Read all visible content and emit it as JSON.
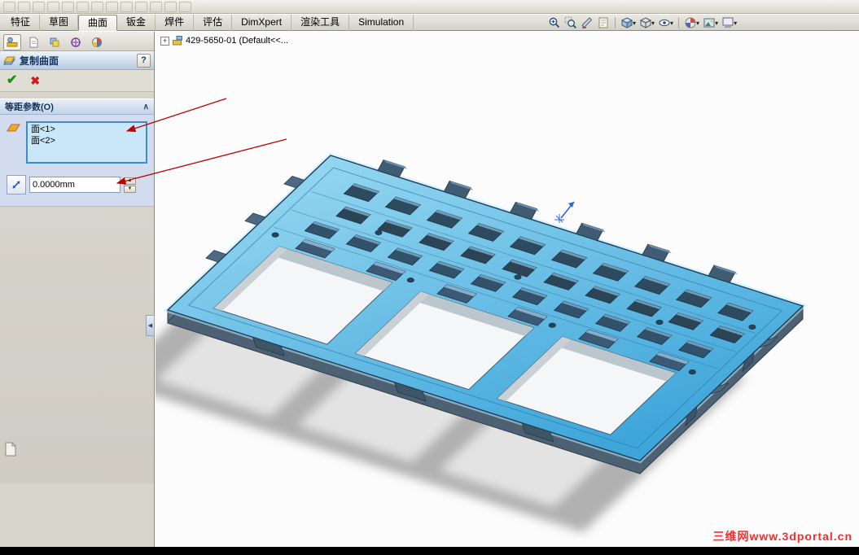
{
  "ribbon": {
    "tabs": [
      "特征",
      "草图",
      "曲面",
      "钣金",
      "焊件",
      "评估",
      "DimXpert",
      "渲染工具",
      "Simulation"
    ],
    "active_tab": "曲面"
  },
  "view_toolbar": {
    "icons": [
      "zoom-to-fit-icon",
      "zoom-area-icon",
      "section-view-icon",
      "annotations-icon",
      "view-orientation-icon",
      "display-style-icon",
      "hide-show-items-icon",
      "edit-appearance-icon",
      "apply-scene-icon",
      "view-settings-icon"
    ]
  },
  "feature_tree": {
    "root_label": "429-5650-01  (Default<<..."
  },
  "property_manager": {
    "title": "复制曲面",
    "section_header": "等距参数(O)",
    "selection_faces": [
      "面<1>",
      "面<2>"
    ],
    "offset_value": "0.0000mm"
  },
  "glyphs": {
    "help": "?",
    "ok": "✔",
    "cancel": "✖",
    "collapse": "∧",
    "dropdown": "▾",
    "spin_up": "▲",
    "spin_down": "▼",
    "splitter": "◀",
    "tree_expand": "+"
  },
  "watermark": "三维网www.3dportal.cn",
  "colors": {
    "highlight_surface": "#4fb2e2",
    "annotation_arrow": "#c00000",
    "watermark_red": "#ff2a2a",
    "selection_box": "#c9e7f9"
  }
}
